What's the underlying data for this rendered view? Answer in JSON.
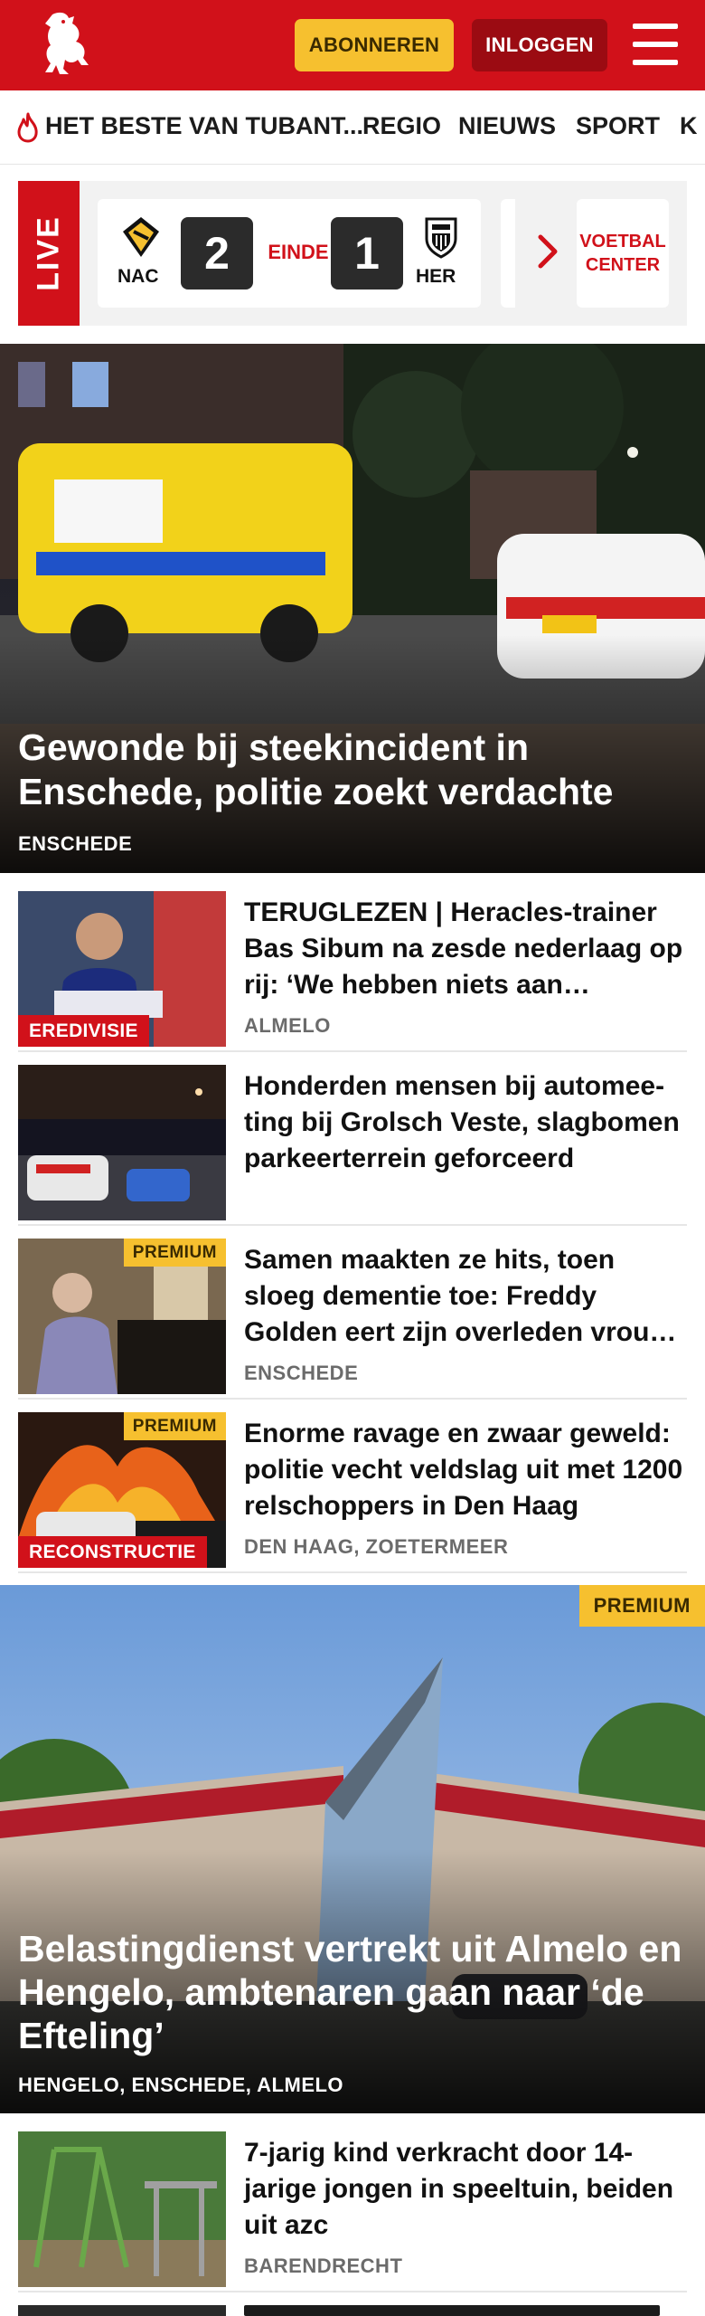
{
  "header": {
    "logo": "tubantia-horse-logo",
    "subscribe_label": "ABONNEREN",
    "login_label": "INLOGGEN",
    "menu_icon": "hamburger-menu-icon",
    "brand_color": "#d1111a"
  },
  "nav": {
    "items": [
      {
        "label": "HET BESTE VAN TUBANT...",
        "icon": "flame-icon"
      },
      {
        "label": "REGIO"
      },
      {
        "label": "NIEUWS"
      },
      {
        "label": "SPORT"
      },
      {
        "label": "K"
      }
    ]
  },
  "live": {
    "tag": "LIVE",
    "match": {
      "home": "NAC",
      "away": "HER",
      "home_score": "2",
      "away_score": "1",
      "status": "EINDE"
    },
    "more_icon": "chevron-right-icon",
    "center_label": "VOETBAL CENTER"
  },
  "hero": {
    "title": "Gewonde bij steekincident in Enschede, politie zoekt verdachte",
    "location": "ENSCHEDE"
  },
  "articles": [
    {
      "title": "TERUGLEZEN | Heracles-trainer Bas Sibum na zesde nederlaag op rij: ‘We hebben niets aan…",
      "location": "ALMELO",
      "label": "EREDIVISIE",
      "premium": ""
    },
    {
      "title": "Honderden mensen bij automee-ting bij Grolsch Veste, slagbomen parkeerterrein geforceerd",
      "location": "",
      "label": "",
      "premium": ""
    },
    {
      "title": "Samen maakten ze hits, toen sloeg dementie toe: Freddy Golden eert zijn overleden vrou…",
      "location": "ENSCHEDE",
      "label": "",
      "premium": "PREMIUM"
    },
    {
      "title": "Enorme ravage en zwaar geweld: politie vecht veldslag uit met 1200 relschoppers in Den Haag",
      "location": "DEN HAAG, ZOETERMEER",
      "label": "RECONSTRUCTIE",
      "premium": "PREMIUM"
    }
  ],
  "hero2": {
    "title": "Belastingdienst vertrekt uit Almelo en Hengelo, ambtenaren gaan naar ‘de Efteling’",
    "location": "HENGELO, ENSCHEDE, ALMELO",
    "premium": "PREMIUM"
  },
  "article_after": {
    "title": "7-jarig kind verkracht door 14-jarige jongen in speeltuin, beiden uit azc",
    "location": "BARENDRECHT"
  }
}
